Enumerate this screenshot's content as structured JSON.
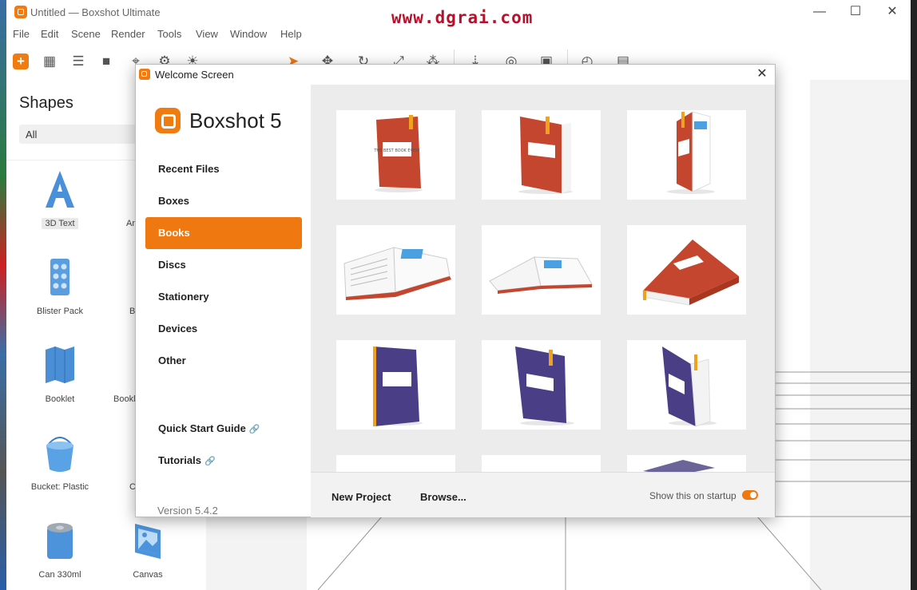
{
  "window": {
    "title": "Untitled — Boxshot Ultimate",
    "watermark": "www.dgrai.com",
    "minimize": "—",
    "maximize": "☐",
    "close": "✕"
  },
  "menu": [
    "File",
    "Edit",
    "Scene",
    "Render",
    "Tools",
    "View",
    "Window",
    "Help"
  ],
  "toolbar": {
    "icons": [
      "add-icon",
      "grid-icon",
      "list-icon",
      "camera-icon",
      "focus-icon",
      "gear-icon",
      "sun-icon",
      "pointer-icon",
      "move-icon",
      "rotate-icon",
      "scale-icon",
      "anchor-icon",
      "drop-icon",
      "target-icon",
      "image-icon",
      "clock-icon",
      "film-icon"
    ]
  },
  "shapes": {
    "title": "Shapes",
    "filter": "All",
    "items": [
      {
        "label": "3D Text"
      },
      {
        "label": "Ang"
      },
      {
        "label": "Blister Pack"
      },
      {
        "label": "B"
      },
      {
        "label": "Booklet"
      },
      {
        "label": "Bookl"
      },
      {
        "label": "Bucket: Plastic"
      },
      {
        "label": "C"
      },
      {
        "label": "Can 330ml"
      },
      {
        "label": "Canvas"
      }
    ]
  },
  "dialog": {
    "title": "Welcome Screen",
    "close": "✕",
    "brand": "Boxshot 5",
    "categories": [
      "Recent Files",
      "Boxes",
      "Books",
      "Discs",
      "Stationery",
      "Devices",
      "Other"
    ],
    "active_category": "Books",
    "links": [
      "Quick Start Guide",
      "Tutorials"
    ],
    "link_icon": "🔗",
    "version": "Version 5.4.2",
    "footer": {
      "new_project": "New Project",
      "browse": "Browse...",
      "startup_label": "Show this on startup",
      "startup_on": true
    },
    "thumb_text": "THE BEST BOOK EVER!",
    "colors": {
      "accent": "#ef7811",
      "red_book": "#c4462f",
      "purple_book": "#4a3f86",
      "ribbon": "#f0a21d"
    }
  }
}
